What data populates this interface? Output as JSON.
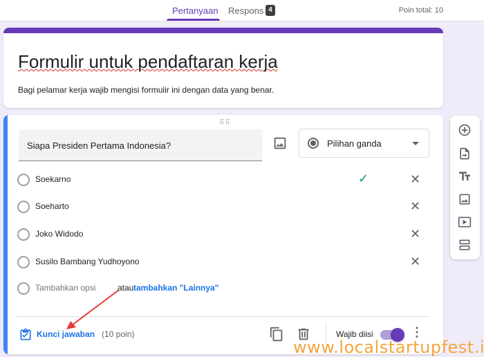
{
  "tabs": [
    {
      "label": "Pertanyaan",
      "active": true
    },
    {
      "label": "Respons",
      "active": false,
      "badge": "4"
    }
  ],
  "poin_total": "Poin total: 10",
  "form": {
    "title": "Formulir untuk pendaftaran kerja",
    "description": "Bagi pelamar kerja wajib mengisi formulir ini dengan data yang benar."
  },
  "question": {
    "text": "Siapa Presiden Pertama Indonesia?",
    "type_label": "Pilihan ganda",
    "options": [
      {
        "label": "Soekarno",
        "correct": true
      },
      {
        "label": "Soeharto",
        "correct": false
      },
      {
        "label": "Joko Widodo",
        "correct": false
      },
      {
        "label": "Susilo Bambang Yudhoyono",
        "correct": false
      }
    ],
    "add_option_label": "Tambahkan opsi",
    "or_label": "atau",
    "add_other_label": "tambahkan \"Lainnya\"",
    "answer_key_label": "Kunci jawaban",
    "points_label": "(10 poin)",
    "required_label": "Wajib diisi",
    "required": true
  },
  "colors": {
    "accent": "#673ab7",
    "question_bar": "#4285f4",
    "link": "#1a73e8",
    "correct": "#0f9d58",
    "annotation_arrow": "#e53935",
    "watermark": "#f4a43b"
  },
  "side_toolbar": [
    "add-question-icon",
    "import-questions-icon",
    "add-title-icon",
    "add-image-icon",
    "add-video-icon",
    "add-section-icon"
  ],
  "watermark": "www.localstartupfest.id"
}
